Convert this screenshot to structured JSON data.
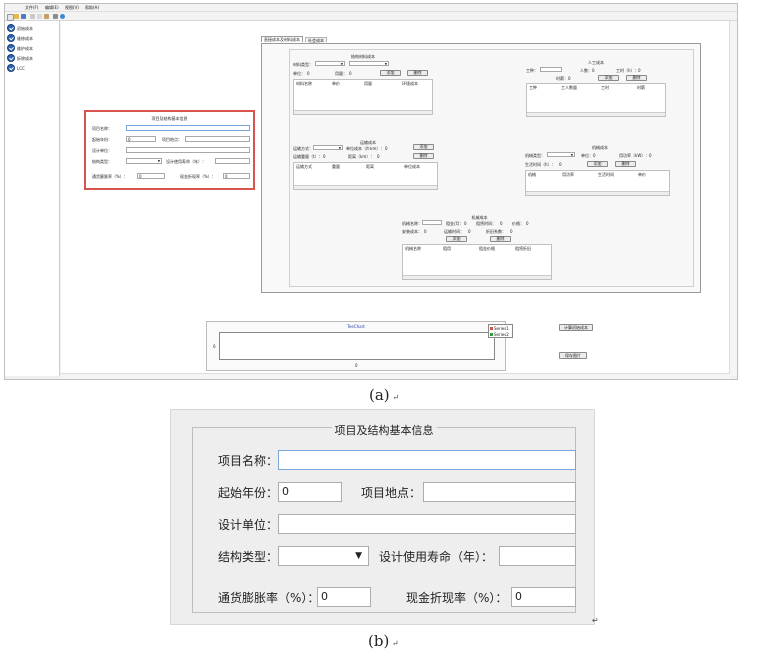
{
  "window": {
    "menu": [
      "文件(F)",
      "编辑(E)",
      "视图(V)",
      "帮助(H)"
    ],
    "sidebar_items": [
      "初始成本",
      "维修成本",
      "维护成本",
      "拆除成本",
      "LCC"
    ],
    "tabs": [
      "直接成本及材料成本",
      "社会成本"
    ],
    "project_panel": {
      "title": "项目及结构基本信息",
      "labels": [
        "项目名称：",
        "起始年份：",
        "项目地点：",
        "设计单位：",
        "结构类型：",
        "设计使用寿命（年）：",
        "通货膨胀率（%）：",
        "现金折现率（%）："
      ],
      "year_value": "0",
      "inflation_value": "0",
      "discount_value": "0"
    },
    "material": {
      "title": "结构材料成本",
      "type_label": "材料类型：",
      "unit_label": "单位：",
      "unit_value": "0",
      "qty_label": "用量：",
      "qty_value": "0",
      "add": "添加",
      "delete": "删除",
      "columns": [
        "材料名称",
        "单价",
        "用量",
        "环境成本"
      ]
    },
    "labor": {
      "title": "人工成本",
      "worker_label": "工种：",
      "people_label": "人数：",
      "people_value": "0",
      "hours_label": "工时（h）：",
      "hours_value": "0",
      "wage_label": "时薪：",
      "wage_value": "0",
      "add": "添加",
      "delete": "删除",
      "columns": [
        "工种",
        "工人数量",
        "工时",
        "时薪"
      ]
    },
    "transport": {
      "title": "运输成本",
      "mode_label": "运输方式：",
      "price_label": "单位成本（/t·km）：",
      "price_value": "0",
      "weight_label": "运输重量（t）：",
      "weight_value": "0",
      "distance_label": "距离（km）：",
      "distance_value": "0",
      "add": "添加",
      "delete": "删除",
      "columns": [
        "运输方式",
        "重量",
        "距离",
        "单位成本"
      ]
    },
    "equipment": {
      "title": "机械成本",
      "type_label": "机械类型：",
      "unit_label": "单位：",
      "unit_value": "0",
      "power_label": "用功率（kW）：",
      "power_value": "0",
      "hours_label": "生活时间（h）：",
      "hours_value": "0",
      "add": "添加",
      "delete": "删除",
      "columns": [
        "机械",
        "用功率",
        "生活时间",
        "单价"
      ]
    },
    "machine": {
      "title": "机械成本",
      "name_label": "机械名称：",
      "rent_label": "租金/月：",
      "rent_value": "0",
      "rent_time_label": "租赁时间：",
      "rent_time_value": "0",
      "price_label": "价格：",
      "price_value": "0",
      "install_label": "安装成本：",
      "install_value": "0",
      "transport_time_label": "运输时间：",
      "transport_time_value": "0",
      "depreciation_label": "折旧系数：",
      "depreciation_value": "0",
      "add": "添加",
      "delete": "删除",
      "columns": [
        "机械名称",
        "租用",
        "租金价格",
        "租赁折旧"
      ]
    },
    "teechart": {
      "title": "TeeChart",
      "y_tick": "0",
      "x_tick": "0",
      "legend": [
        "Series1",
        "Series2"
      ]
    },
    "buttons": {
      "calc": "计算初始成本",
      "save": "保存图片"
    }
  },
  "caption_a": "(a)",
  "caption_b": "(b)",
  "detail": {
    "title": "项目及结构基本信息",
    "project_name_label": "项目名称：",
    "start_year_label": "起始年份：",
    "start_year_value": "0",
    "location_label": "项目地点：",
    "design_unit_label": "设计单位：",
    "structure_type_label": "结构类型：",
    "service_life_label": "设计使用寿命（年）：",
    "inflation_label": "通货膨胀率（%）：",
    "inflation_value": "0",
    "discount_label": "现金折现率（%）：",
    "discount_value": "0"
  }
}
